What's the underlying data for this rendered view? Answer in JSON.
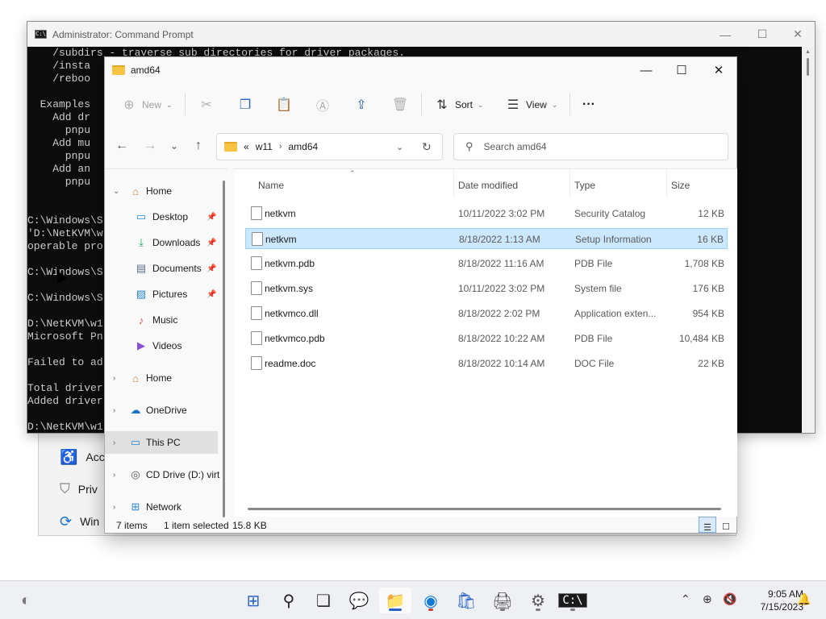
{
  "settings_bg": {
    "rows": [
      {
        "label": "Acc",
        "icon": "accessibility-icon"
      },
      {
        "label": "Priv",
        "icon": "shield-icon"
      },
      {
        "label": "Win",
        "icon": "sync-icon"
      }
    ]
  },
  "cmd": {
    "title": "Administrator: Command Prompt",
    "lines": [
      "    /subdirs - traverse sub directories for driver packages.",
      "    /insta",
      "    /reboo",
      "",
      "  Examples",
      "    Add dr",
      "      pnpu",
      "    Add mu",
      "      pnpu",
      "    Add an",
      "      pnpu",
      "",
      "",
      "C:\\Windows\\S",
      "'D:\\NetKVM\\w",
      "operable pro",
      "",
      "C:\\Windows\\S",
      "",
      "C:\\Windows\\S",
      "",
      "D:\\NetKVM\\w1",
      "Microsoft Pn",
      "",
      "Failed to ad",
      "",
      "Total driver",
      "Added driver",
      "",
      "D:\\NetKVM\\w1"
    ]
  },
  "explorer": {
    "title": "amd64",
    "toolbar": {
      "new_label": "New",
      "sort_label": "Sort",
      "view_label": "View",
      "more_label": "···"
    },
    "address": {
      "overflow": "«",
      "crumbs": [
        "w11",
        "amd64"
      ]
    },
    "search": {
      "placeholder": "Search amd64"
    },
    "nav_pane": {
      "home_expanded_label": "Home",
      "quick_access": [
        {
          "label": "Desktop",
          "icon": "desktop-icon"
        },
        {
          "label": "Downloads",
          "icon": "downloads-icon"
        },
        {
          "label": "Documents",
          "icon": "documents-icon"
        },
        {
          "label": "Pictures",
          "icon": "pictures-icon"
        },
        {
          "label": "Music",
          "icon": "music-icon"
        },
        {
          "label": "Videos",
          "icon": "videos-icon"
        }
      ],
      "roots": [
        {
          "label": "Home",
          "icon": "home-icon"
        },
        {
          "label": "OneDrive",
          "icon": "onedrive-icon"
        },
        {
          "label": "This PC",
          "icon": "this-pc-icon",
          "selected": true
        },
        {
          "label": "CD Drive (D:) virt",
          "icon": "cd-drive-icon"
        },
        {
          "label": "Network",
          "icon": "network-icon"
        }
      ]
    },
    "columns": {
      "name": "Name",
      "date": "Date modified",
      "type": "Type",
      "size": "Size"
    },
    "files": [
      {
        "name": "netkvm",
        "date": "10/11/2022 3:02 PM",
        "type": "Security Catalog",
        "size": "12 KB",
        "selected": false
      },
      {
        "name": "netkvm",
        "date": "8/18/2022 1:13 AM",
        "type": "Setup Information",
        "size": "16 KB",
        "selected": true
      },
      {
        "name": "netkvm.pdb",
        "date": "8/18/2022 11:16 AM",
        "type": "PDB File",
        "size": "1,708 KB",
        "selected": false
      },
      {
        "name": "netkvm.sys",
        "date": "10/11/2022 3:02 PM",
        "type": "System file",
        "size": "176 KB",
        "selected": false
      },
      {
        "name": "netkvmco.dll",
        "date": "8/18/2022 2:02 PM",
        "type": "Application exten...",
        "size": "954 KB",
        "selected": false
      },
      {
        "name": "netkvmco.pdb",
        "date": "8/18/2022 10:22 AM",
        "type": "PDB File",
        "size": "10,484 KB",
        "selected": false
      },
      {
        "name": "readme.doc",
        "date": "8/18/2022 10:14 AM",
        "type": "DOC File",
        "size": "22 KB",
        "selected": false
      }
    ],
    "status": {
      "items": "7 items",
      "selected": "1 item selected",
      "size": "15.8 KB"
    }
  },
  "taskbar": {
    "time": "9:05 AM",
    "date": "7/15/2023"
  }
}
